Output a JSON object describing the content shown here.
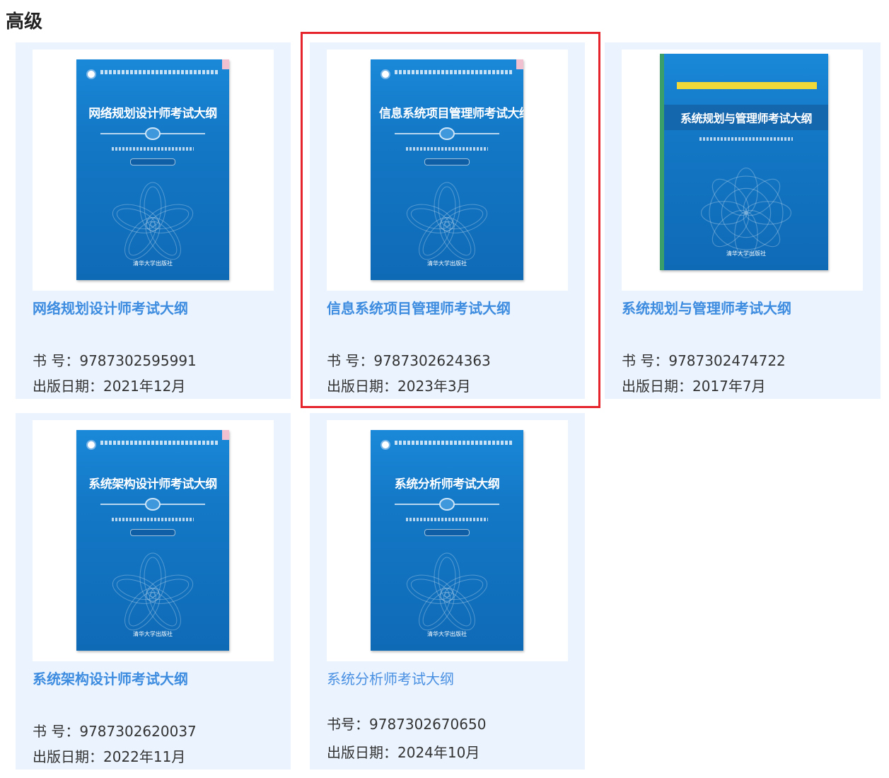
{
  "section": {
    "title": "高级"
  },
  "books": [
    {
      "title": "网络规划设计师考试大纲",
      "isbn_label": "书 号：",
      "isbn": "9787302595991",
      "date_label": "出版日期：",
      "date": "2021年12月",
      "cover_title": "网络规划设计师考试大纲",
      "cover_publisher": "清华大学出版社"
    },
    {
      "title": "信息系统项目管理师考试大纲",
      "isbn_label": "书 号：",
      "isbn": "9787302624363",
      "date_label": "出版日期：",
      "date": "2023年3月",
      "cover_title": "信息系统项目管理师考试大纲",
      "cover_publisher": "清华大学出版社",
      "highlighted": true
    },
    {
      "title": "系统规划与管理师考试大纲",
      "isbn_label": "书 号：",
      "isbn": "9787302474722",
      "date_label": "出版日期：",
      "date": "2017年7月",
      "cover_title": "系统规划与管理师考试大纲",
      "cover_publisher": "清华大学出版社"
    },
    {
      "title": "系统架构设计师考试大纲",
      "isbn_label": "书 号：",
      "isbn": "9787302620037",
      "date_label": "出版日期：",
      "date": "2022年11月",
      "cover_title": "系统架构设计师考试大纲",
      "cover_publisher": "清华大学出版社"
    },
    {
      "title": "系统分析师考试大纲",
      "isbn_label": "书号：",
      "isbn": "9787302670650",
      "date_label": "出版日期：",
      "date": "2024年10月",
      "cover_title": "系统分析师考试大纲",
      "cover_publisher": "清华大学出版社"
    }
  ],
  "colors": {
    "card_bg": "#eaf3fe",
    "title_link": "#3d8ce0",
    "highlight_border": "#e5242b",
    "cover_blue": "#1378c6"
  }
}
